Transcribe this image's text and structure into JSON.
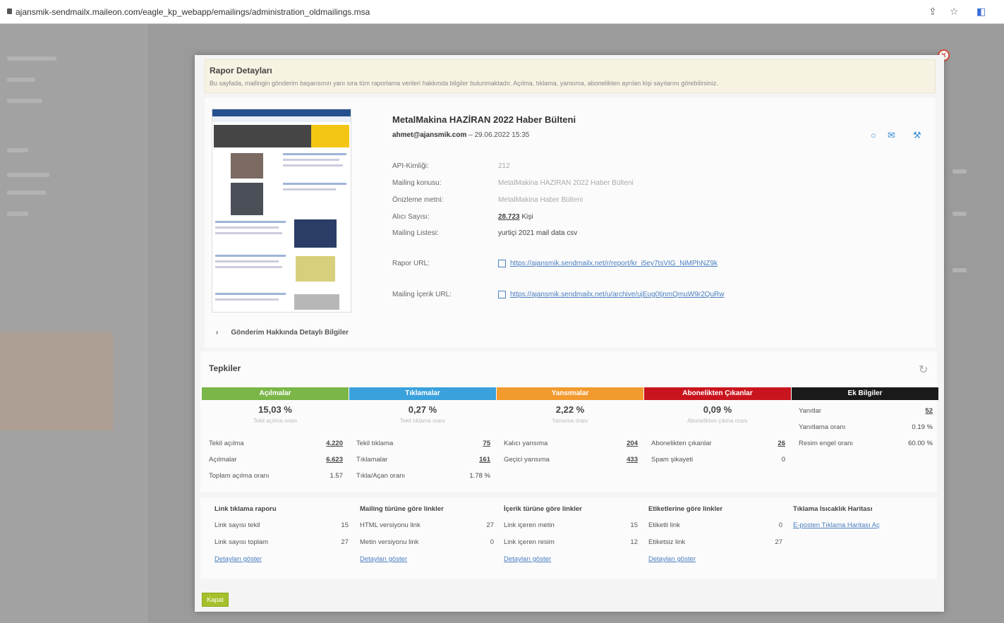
{
  "browser": {
    "url": "ajansmik-sendmailx.maileon.com/eagle_kp_webapp/emailings/administration_oldmailings.msa"
  },
  "notice": {
    "title": "Rapor Detayları",
    "text": "Bu sayfada, mailingin gönderim başarısının yanı sıra tüm raporlama verileri hakkında bilgiler bulunmaktadır. Açılma, tıklama, yansıma, abonelikten ayrılan kişi sayılarını görebilirsiniz."
  },
  "mailing": {
    "title": "MetalMakina HAZİRAN 2022 Haber Bülteni",
    "sender": "ahmet@ajansmik.com",
    "date": "– 29.06.2022 15:35",
    "fields": [
      {
        "label": "API-Kimliği:",
        "value": "212"
      },
      {
        "label": "Mailing konusu:",
        "value": "MetalMakina HAZİRAN 2022 Haber Bülteni"
      },
      {
        "label": "Önizleme metni:",
        "value": "MetalMakina Haber Bülteni"
      },
      {
        "label": "Alıcı Sayısı:",
        "value": "28.723",
        "suffix": "Kişi"
      },
      {
        "label": "Mailing Listesi:",
        "value": "yurtiçi 2021 mail data csv"
      }
    ],
    "report_url_label": "Rapor URL:",
    "report_url": "https://ajansmik.sendmailx.net/r/report/kr_i5ey7tsVIG_NiMPhNZ9k",
    "content_url_label": "Mailing İçerik URL:",
    "content_url": "https://ajansmik.sendmailx.net/u/archive/ujEug0tjnmQmuW9r2QuRw",
    "detail_toggle": "Gönderim Hakkında Detaylı Bilgiler"
  },
  "reactions": {
    "title": "Tepkiler",
    "columns": [
      {
        "header": "Açılmalar",
        "color": "#7ab648",
        "big": "15,03 %",
        "small": "Tekil açılma oranı",
        "rows": [
          {
            "label": "Tekil açılma",
            "value": "4.220",
            "link": true
          },
          {
            "label": "Açılmalar",
            "value": "6.623",
            "link": true
          },
          {
            "label": "Toplam açılma oranı",
            "value": "1.57",
            "link": false
          }
        ]
      },
      {
        "header": "Tıklamalar",
        "color": "#3aa1dc",
        "big": "0,27 %",
        "small": "Tekil tıklama oranı",
        "rows": [
          {
            "label": "Tekil tıklama",
            "value": "75",
            "link": true
          },
          {
            "label": "Tıklamalar",
            "value": "161",
            "link": true
          },
          {
            "label": "Tıkla/Açan oranı",
            "value": "1.78 %",
            "link": false
          }
        ]
      },
      {
        "header": "Yansımalar",
        "color": "#f29a2e",
        "big": "2,22 %",
        "small": "Yansıma oranı",
        "rows": [
          {
            "label": "Kalıcı yansıma",
            "value": "204",
            "link": true
          },
          {
            "label": "Geçici yansıma",
            "value": "433",
            "link": true
          }
        ]
      },
      {
        "header": "Abonelikten Çıkanlar",
        "color": "#c9141e",
        "big": "0,09 %",
        "small": "Abonelikten çıkma oranı",
        "rows": [
          {
            "label": "Abonelikten çıkanlar",
            "value": "26",
            "link": true
          },
          {
            "label": "Spam şikayeti",
            "value": "0",
            "link": false
          }
        ]
      },
      {
        "header": "Ek Bilgiler",
        "color": "#1a1a1a",
        "rows": [
          {
            "label": "Yanıtlar",
            "value": "52",
            "link": true
          },
          {
            "label": "Yanıtlama oranı",
            "value": "0.19 %",
            "link": false
          },
          {
            "label": "Resim engel oranı",
            "value": "60.00 %",
            "link": false
          }
        ]
      }
    ]
  },
  "links": [
    {
      "title": "Link tıklama raporu",
      "rows": [
        {
          "label": "Link sayısı tekil",
          "value": "15"
        },
        {
          "label": "Link sayısı toplam",
          "value": "27"
        }
      ],
      "action": "Detayları göster"
    },
    {
      "title": "Mailing türüne göre linkler",
      "rows": [
        {
          "label": "HTML versiyonu link",
          "value": "27"
        },
        {
          "label": "Metin versiyonu link",
          "value": "0"
        }
      ],
      "action": "Detayları göster"
    },
    {
      "title": "İçerik türüne göre linkler",
      "rows": [
        {
          "label": "Link içeren metin",
          "value": "15"
        },
        {
          "label": "Link içeren resim",
          "value": "12"
        }
      ],
      "action": "Detayları göster"
    },
    {
      "title": "Etiketlerine göre linkler",
      "rows": [
        {
          "label": "Etiketli link",
          "value": "0"
        },
        {
          "label": "Etiketsiz link",
          "value": "27"
        }
      ],
      "action": "Detayları göster"
    },
    {
      "title": "Tıklama Isıcaklık Haritası",
      "rows": [],
      "action": "E-posten Tıklama Haritası Aç"
    }
  ],
  "close_label": "Kapat"
}
